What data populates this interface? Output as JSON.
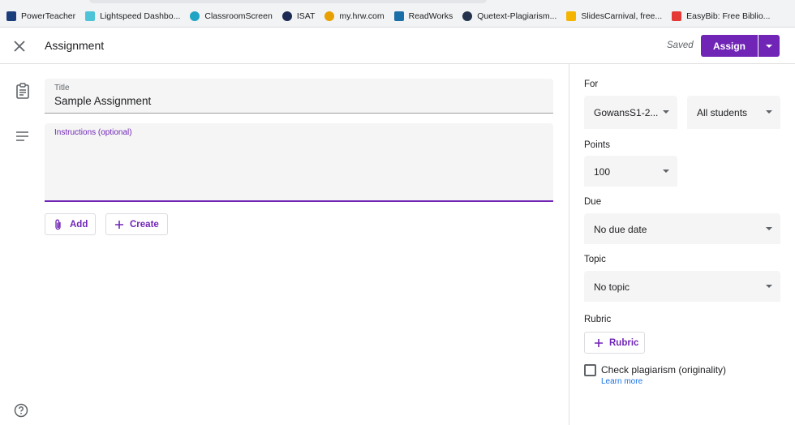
{
  "bookmarks": [
    {
      "label": "PowerTeacher",
      "icon": "powerteacher-icon",
      "color": "#1a3d7c"
    },
    {
      "label": "Lightspeed Dashbo...",
      "icon": "lightspeed-icon",
      "color": "#4fc3d8"
    },
    {
      "label": "ClassroomScreen",
      "icon": "classroomscreen-icon",
      "color": "#1fa4c4"
    },
    {
      "label": "ISAT",
      "icon": "isat-icon",
      "color": "#1b2a55"
    },
    {
      "label": "my.hrw.com",
      "icon": "hrw-icon",
      "color": "#e8a000"
    },
    {
      "label": "ReadWorks",
      "icon": "readworks-icon",
      "color": "#1b6fa8"
    },
    {
      "label": "Quetext-Plagiarism...",
      "icon": "quetext-icon",
      "color": "#24324d"
    },
    {
      "label": "SlidesCarnival, free...",
      "icon": "slidescarnival-icon",
      "color": "#f4b400"
    },
    {
      "label": "EasyBib: Free Biblio...",
      "icon": "easybib-icon",
      "color": "#e53935"
    }
  ],
  "header": {
    "title": "Assignment",
    "saved": "Saved",
    "assign_label": "Assign"
  },
  "form": {
    "title_label": "Title",
    "title_value": "Sample Assignment",
    "instructions_label": "Instructions (optional)",
    "add_label": "Add",
    "create_label": "Create"
  },
  "sidebar": {
    "for_label": "For",
    "class_value": "GowansS1-2...",
    "students_value": "All students",
    "points_label": "Points",
    "points_value": "100",
    "due_label": "Due",
    "due_value": "No due date",
    "topic_label": "Topic",
    "topic_value": "No topic",
    "rubric_label": "Rubric",
    "rubric_button": "Rubric",
    "plagiarism_label": "Check plagiarism (originality)",
    "learn_more": "Learn more"
  },
  "colors": {
    "accent": "#7025b6",
    "link": "#1a73e8"
  }
}
